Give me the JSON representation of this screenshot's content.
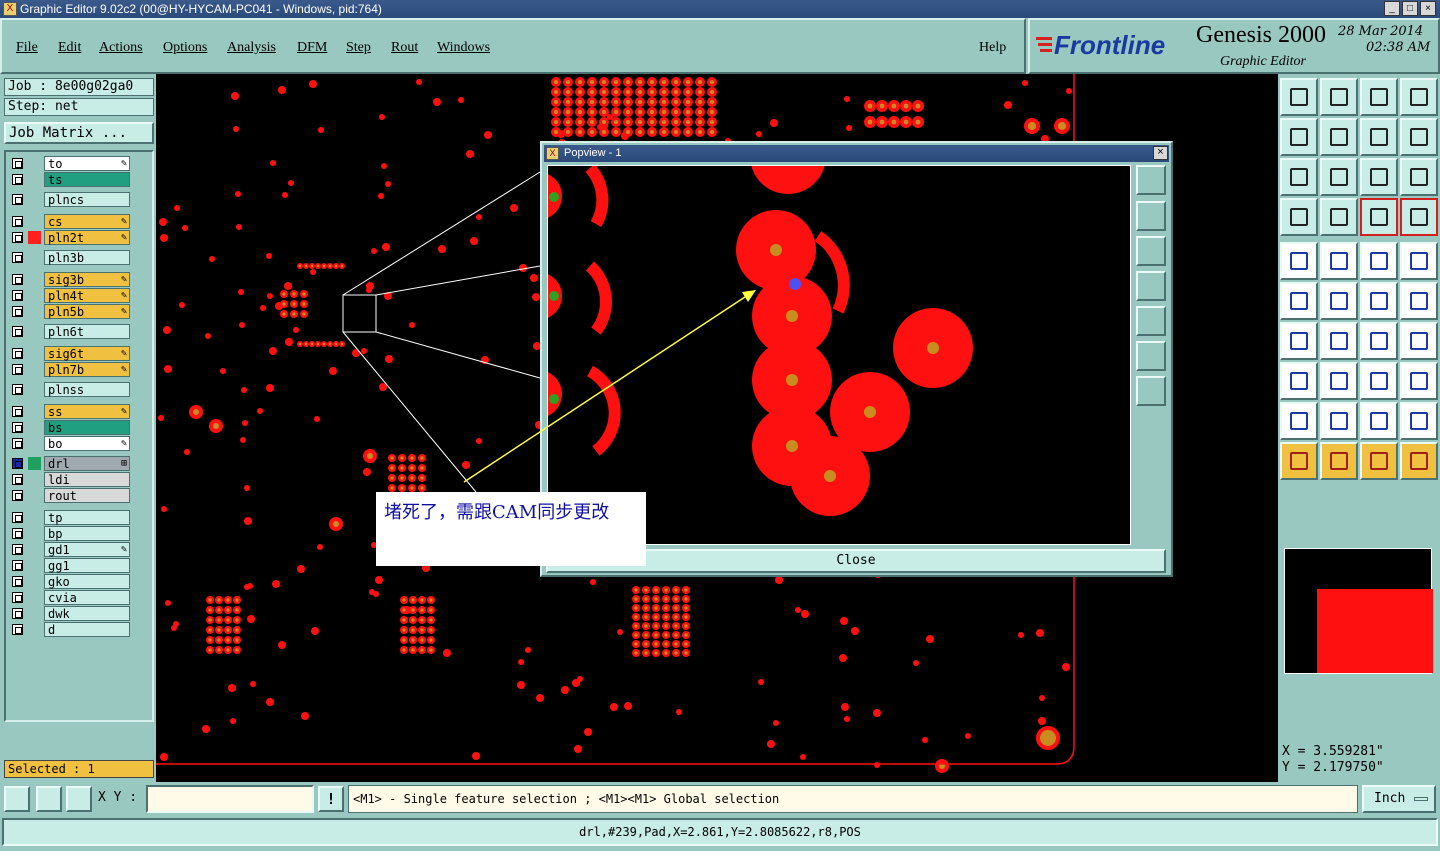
{
  "window": {
    "title": "Graphic Editor 9.02c2 (00@HY-HYCAM-PC041 - Windows, pid:764)"
  },
  "menu": [
    "File",
    "Edit",
    "Actions",
    "Options",
    "Analysis",
    "DFM",
    "Step",
    "Rout",
    "Windows"
  ],
  "help": "Help",
  "brand": {
    "logo": "Frontline",
    "product": "Genesis 2000",
    "subtitle": "Graphic Editor",
    "date": "28 Mar 2014",
    "time": "02:38 AM"
  },
  "job": {
    "job_label": "Job : 8e00g02ga0",
    "step_label": "Step: net",
    "matrix_button": "Job Matrix ..."
  },
  "layers": [
    {
      "name": "to",
      "color": "#ffffff",
      "mark": "✎"
    },
    {
      "name": "ts",
      "color": "#20a080",
      "mark": ""
    },
    {
      "name": "plncs",
      "color": "#c8ece6",
      "mark": ""
    },
    {
      "name": "cs",
      "color": "#f0c040",
      "mark": "✎"
    },
    {
      "name": "pln2t",
      "color": "#f0c040",
      "mark": "✎",
      "swatch": "#ff2020"
    },
    {
      "name": "pln3b",
      "color": "#c8ece6",
      "mark": ""
    },
    {
      "name": "sig3b",
      "color": "#f0c040",
      "mark": "✎"
    },
    {
      "name": "pln4t",
      "color": "#f0c040",
      "mark": "✎"
    },
    {
      "name": "pln5b",
      "color": "#f0c040",
      "mark": "✎"
    },
    {
      "name": "pln6t",
      "color": "#c8ece6",
      "mark": ""
    },
    {
      "name": "sig6t",
      "color": "#f0c040",
      "mark": "✎"
    },
    {
      "name": "pln7b",
      "color": "#f0c040",
      "mark": "✎"
    },
    {
      "name": "plnss",
      "color": "#c8ece6",
      "mark": ""
    },
    {
      "name": "ss",
      "color": "#f0c040",
      "mark": "✎"
    },
    {
      "name": "bs",
      "color": "#20a080",
      "mark": ""
    },
    {
      "name": "bo",
      "color": "#ffffff",
      "mark": "✎"
    },
    {
      "name": "drl",
      "color": "#a0a8b0",
      "mark": "⊞",
      "swatch": "#20a060",
      "active": true
    },
    {
      "name": "ldi",
      "color": "#d8d8d8",
      "mark": ""
    },
    {
      "name": "rout",
      "color": "#d8d8d8",
      "mark": ""
    },
    {
      "name": "tp",
      "color": "#c8ece6",
      "mark": ""
    },
    {
      "name": "bp",
      "color": "#c8ece6",
      "mark": ""
    },
    {
      "name": "gd1",
      "color": "#c8ece6",
      "mark": "✎"
    },
    {
      "name": "gg1",
      "color": "#c8ece6",
      "mark": ""
    },
    {
      "name": "gko",
      "color": "#c8ece6",
      "mark": ""
    },
    {
      "name": "cvia",
      "color": "#c8ece6",
      "mark": ""
    },
    {
      "name": "dwk",
      "color": "#c8ece6",
      "mark": ""
    },
    {
      "name": "d",
      "color": "#c8ece6",
      "mark": ""
    }
  ],
  "selected": "Selected : 1",
  "popview": {
    "title": "Popview - 1",
    "close": "Close"
  },
  "annotation": "堵死了，需跟CAM同步更改",
  "coords": {
    "x": "X = 3.559281\"",
    "y": "Y = 2.179750\""
  },
  "xy": {
    "label": "X Y :",
    "value": ""
  },
  "message": "<M1> - Single feature selection ; <M1><M1> Global selection",
  "unit": "Inch",
  "status": "drl,#239,Pad,X=2.861,Y=2.8085622,r8,POS",
  "colors": {
    "pad_red": "#ff1010",
    "pad_center": "#c88c20",
    "panel": "#98c8c0"
  }
}
